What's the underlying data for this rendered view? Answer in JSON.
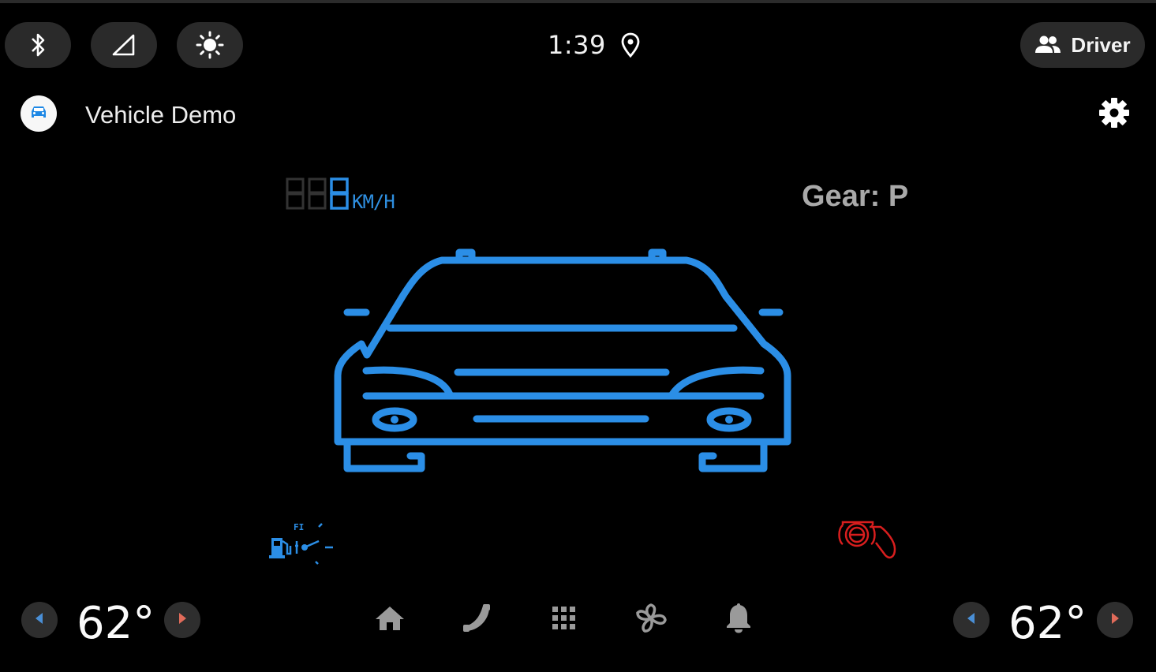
{
  "status_bar": {
    "icons": [
      "bluetooth-icon",
      "cellular-signal-icon",
      "brightness-icon"
    ],
    "time": "1:39",
    "location_icon": "location-pin-icon",
    "user_label": "Driver",
    "user_icon": "people-icon"
  },
  "app": {
    "title": "Vehicle Demo",
    "icon": "car-icon",
    "settings_icon": "gear-icon"
  },
  "dashboard": {
    "speed_digits": "8",
    "speed_unit": "KM/H",
    "gear": "Gear: P",
    "warnings": [
      "fuel-warning-icon",
      "parking-brake-icon"
    ],
    "accent_color": "#2b8ee6",
    "warning_color": "#d81e1e"
  },
  "climate": {
    "left_temp": "62°",
    "right_temp": "62°"
  },
  "nav": {
    "items": [
      "home-icon",
      "phone-icon",
      "apps-grid-icon",
      "fan-icon",
      "bell-icon"
    ]
  }
}
